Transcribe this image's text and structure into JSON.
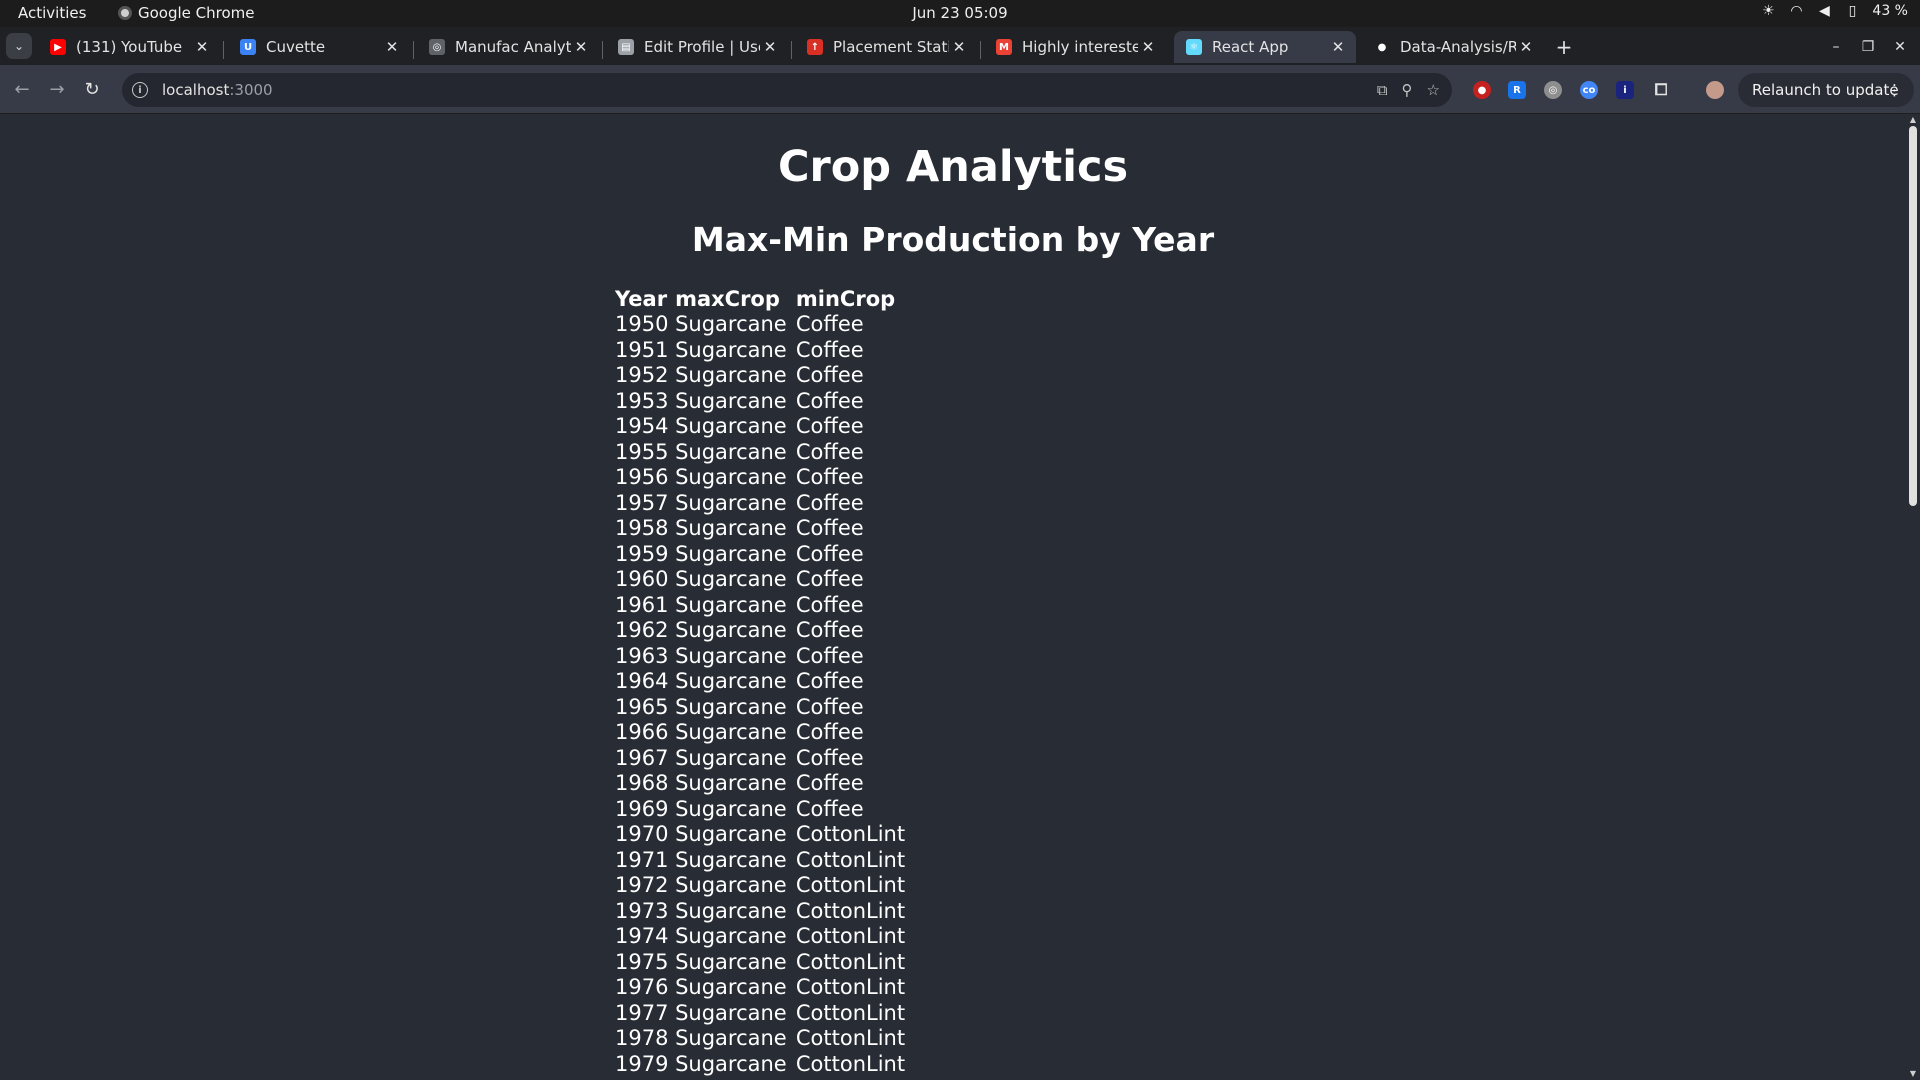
{
  "topbar": {
    "activities": "Activities",
    "app_name": "Google Chrome",
    "clock": "Jun 23  05:09",
    "battery": "43 %"
  },
  "tabs": [
    {
      "title": "(131) YouTube",
      "icon": "youtube-icon",
      "color": "#ff0000",
      "glyph": "▶"
    },
    {
      "title": "Cuvette",
      "icon": "cuvette-icon",
      "color": "#3b82f6",
      "glyph": "U"
    },
    {
      "title": "Manufac Analytic",
      "icon": "globe-icon",
      "color": "#5f6368",
      "glyph": "◎"
    },
    {
      "title": "Edit Profile | User",
      "icon": "document-icon",
      "color": "#9aa0a6",
      "glyph": "▤"
    },
    {
      "title": "Placement Statist",
      "icon": "upload-arrow-icon",
      "color": "#d93025",
      "glyph": "↑"
    },
    {
      "title": "Highly interested",
      "icon": "gmail-icon",
      "color": "#ea4335",
      "glyph": "M"
    },
    {
      "title": "React App",
      "icon": "react-icon",
      "color": "#61dafb",
      "glyph": "⚛"
    },
    {
      "title": "Data-Analysis/RE",
      "icon": "github-icon",
      "color": "#202124",
      "glyph": "●"
    }
  ],
  "toolbar": {
    "url_host": "localhost",
    "url_port": ":3000",
    "relaunch_label": "Relaunch to update"
  },
  "page": {
    "title": "Crop Analytics",
    "subtitle": "Max-Min Production by Year",
    "headers": {
      "year": "Year",
      "max": "maxCrop",
      "min": "minCrop"
    },
    "rows": [
      {
        "year": "1950",
        "max": "Sugarcane",
        "min": "Coffee"
      },
      {
        "year": "1951",
        "max": "Sugarcane",
        "min": "Coffee"
      },
      {
        "year": "1952",
        "max": "Sugarcane",
        "min": "Coffee"
      },
      {
        "year": "1953",
        "max": "Sugarcane",
        "min": "Coffee"
      },
      {
        "year": "1954",
        "max": "Sugarcane",
        "min": "Coffee"
      },
      {
        "year": "1955",
        "max": "Sugarcane",
        "min": "Coffee"
      },
      {
        "year": "1956",
        "max": "Sugarcane",
        "min": "Coffee"
      },
      {
        "year": "1957",
        "max": "Sugarcane",
        "min": "Coffee"
      },
      {
        "year": "1958",
        "max": "Sugarcane",
        "min": "Coffee"
      },
      {
        "year": "1959",
        "max": "Sugarcane",
        "min": "Coffee"
      },
      {
        "year": "1960",
        "max": "Sugarcane",
        "min": "Coffee"
      },
      {
        "year": "1961",
        "max": "Sugarcane",
        "min": "Coffee"
      },
      {
        "year": "1962",
        "max": "Sugarcane",
        "min": "Coffee"
      },
      {
        "year": "1963",
        "max": "Sugarcane",
        "min": "Coffee"
      },
      {
        "year": "1964",
        "max": "Sugarcane",
        "min": "Coffee"
      },
      {
        "year": "1965",
        "max": "Sugarcane",
        "min": "Coffee"
      },
      {
        "year": "1966",
        "max": "Sugarcane",
        "min": "Coffee"
      },
      {
        "year": "1967",
        "max": "Sugarcane",
        "min": "Coffee"
      },
      {
        "year": "1968",
        "max": "Sugarcane",
        "min": "Coffee"
      },
      {
        "year": "1969",
        "max": "Sugarcane",
        "min": "Coffee"
      },
      {
        "year": "1970",
        "max": "Sugarcane",
        "min": "CottonLint"
      },
      {
        "year": "1971",
        "max": "Sugarcane",
        "min": "CottonLint"
      },
      {
        "year": "1972",
        "max": "Sugarcane",
        "min": "CottonLint"
      },
      {
        "year": "1973",
        "max": "Sugarcane",
        "min": "CottonLint"
      },
      {
        "year": "1974",
        "max": "Sugarcane",
        "min": "CottonLint"
      },
      {
        "year": "1975",
        "max": "Sugarcane",
        "min": "CottonLint"
      },
      {
        "year": "1976",
        "max": "Sugarcane",
        "min": "CottonLint"
      },
      {
        "year": "1977",
        "max": "Sugarcane",
        "min": "CottonLint"
      },
      {
        "year": "1978",
        "max": "Sugarcane",
        "min": "CottonLint"
      },
      {
        "year": "1979",
        "max": "Sugarcane",
        "min": "CottonLint"
      }
    ]
  },
  "colors": {
    "page_bg": "#282c34",
    "chrome_frame": "#202124",
    "active_tab": "#373a47"
  }
}
